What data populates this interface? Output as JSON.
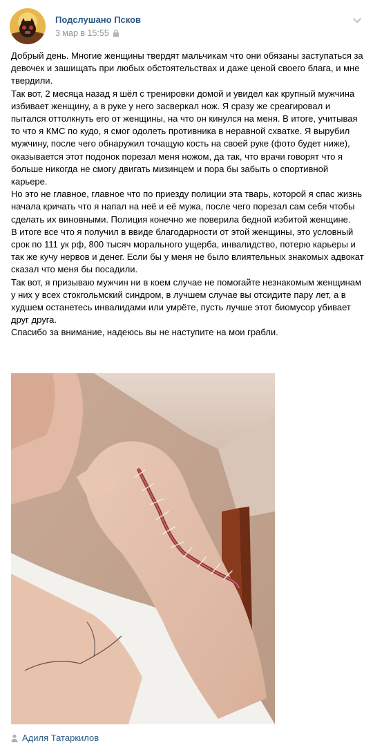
{
  "post": {
    "author": "Подслушано Псков",
    "date": "3 мар в 15:55",
    "paragraphs": [
      "Добрый день. Многие женщины твердят мальчикам что они обязаны заступаться за девочек и зашищать при любых обстоятельствах и даже ценой своего блага, и мне твердили.",
      "Так вот, 2 месяца назад я шёл с тренировки домой и увидел как крупный мужчина избивает женщину, а в руке у него засверкал нож. Я сразу же среагировал и пытался оттолкнуть его от женщины, на что он кинулся на меня. В итоге, учитывая то что я КМС по кудо, я смог одолеть противника в неравной схватке. Я вырубил мужчину, после чего обнаружил точащую кость на своей руке (фото будет ниже), оказывается этот подонок порезал меня ножом, да так, что врачи говорят что я больше никогда не смогу двигать мизинцем и пора бы забыть о спортивной карьере.",
      "Но это не главное, главное что по приезду полиции эта тварь, которой я спас жизнь начала кричать что я напал на неё и её мужа, после чего порезал сам себя чтобы сделать их виновными. Полиция конечно же поверила бедной избитой женщине.",
      "В итоге все что я получил в ввиде благодарности от этой женщины, это условный срок по 111 ук рф, 800 тысяч морального ущерба, инвалидство, потерю карьеры и так же кучу нервов и денег. Если бы у меня не было влиятельных знакомых адвокат сказал что меня бы посадили.",
      "Так вот, я призываю мужчин ни в коем случае не помогайте незнакомым женщинам у них у всех стокгольмский синдром, в лучшем случае вы отсидите пару лет, а в худшем останетесь инвалидами или умрёте, пусть лучше этот биомусор убивает друг друга.",
      "Спасибо за внимание, надеюсь вы не наступите на мои грабли."
    ],
    "signer": "Адиля Татаркилов"
  },
  "icons": {
    "avatar": "community-avatar-icon",
    "lock": "lock-icon",
    "menu": "chevron-down-icon",
    "signer": "person-icon"
  },
  "colors": {
    "link": "#2a5885",
    "meta": "#939393",
    "text": "#000000"
  }
}
